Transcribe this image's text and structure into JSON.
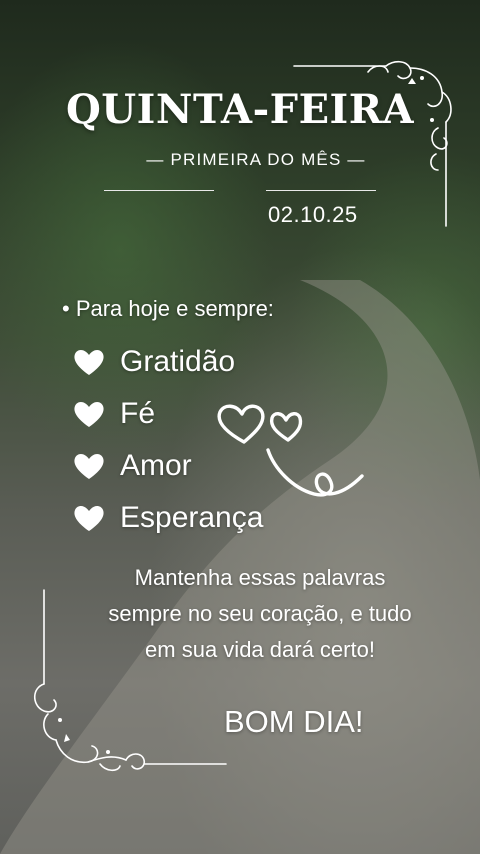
{
  "header": {
    "title": "QUINTA-FEIRA",
    "subtitle": "— PRIMEIRA DO MÊS —",
    "date": "02.10.25"
  },
  "content": {
    "intro": "• Para hoje e sempre:",
    "words": [
      "Gratidão",
      "Fé",
      "Amor",
      "Esperança"
    ],
    "message_lines": [
      "Mantenha essas palavras",
      "sempre no seu coração, e tudo",
      "em sua vida dará certo!"
    ],
    "greeting": "BOM DIA!"
  },
  "icons": {
    "word_bullet": "heart-icon",
    "decoration": "doodle-hearts-icon",
    "corners": "flourish-corner-icon"
  },
  "colors": {
    "text": "#ffffff",
    "rule": "#e9e9e9"
  }
}
